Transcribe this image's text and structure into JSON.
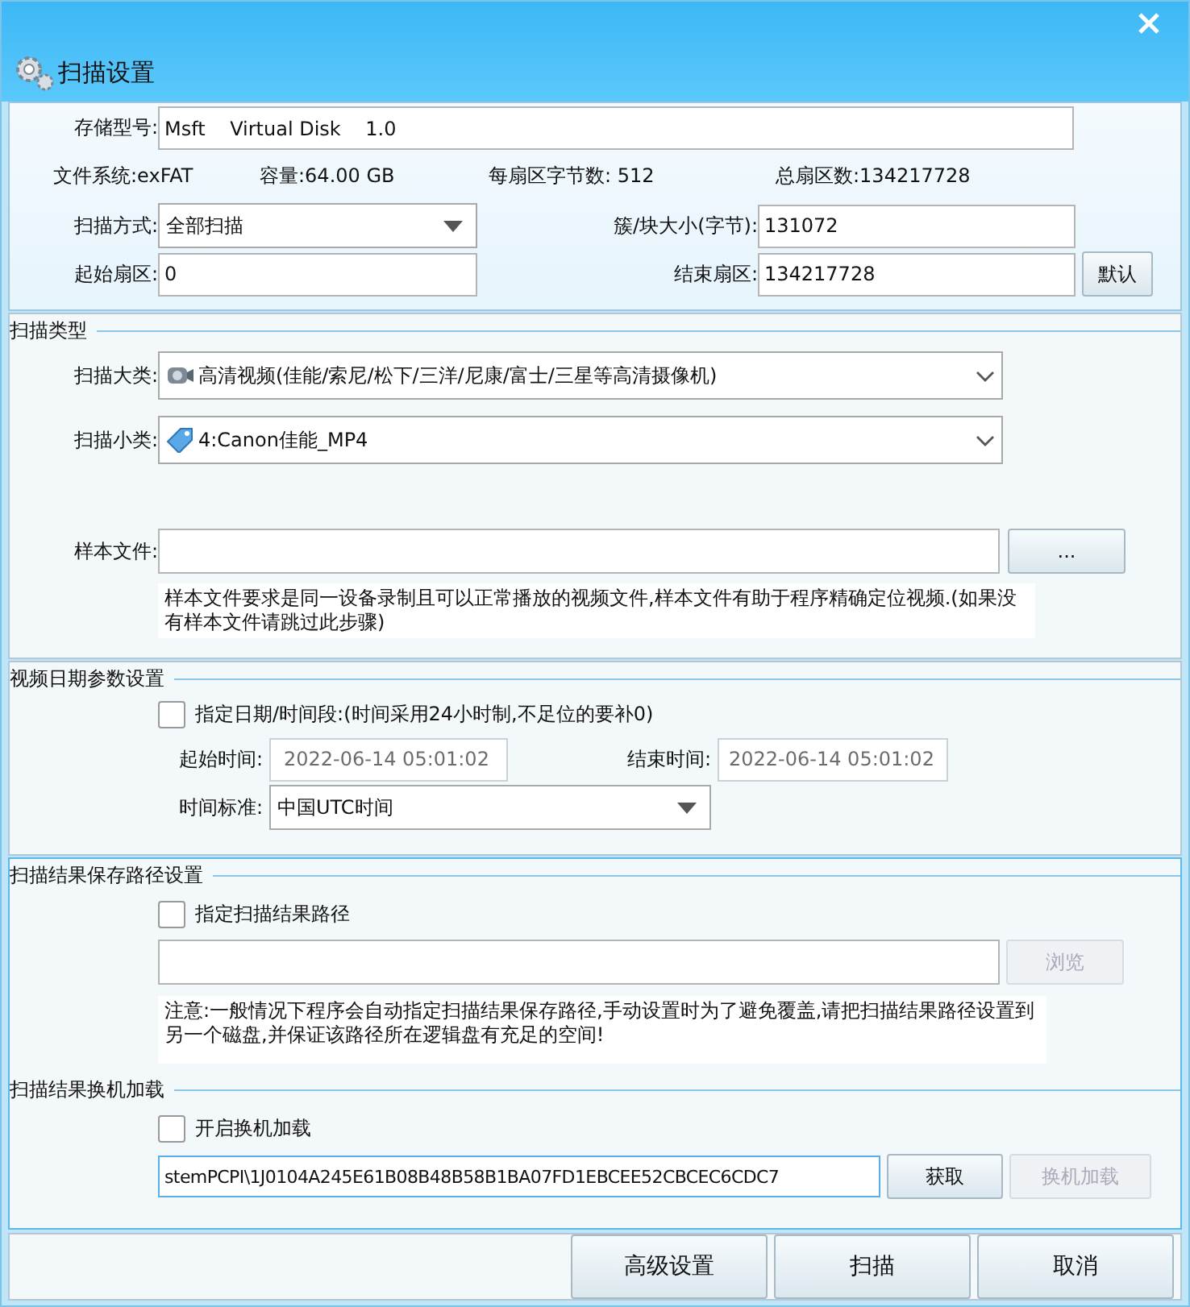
{
  "window": {
    "title": "扫描设置"
  },
  "disk": {
    "model_label": "存储型号:",
    "model": "Msft    Virtual Disk    1.0",
    "info": [
      "文件系统:exFAT",
      "容量:64.00 GB",
      "每扇区字节数: 512",
      "总扇区数:134217728"
    ],
    "scan_mode": {
      "label": "扫描方式:",
      "value": "全部扫描"
    },
    "cluster": {
      "label": "簇/块大小(字节):",
      "value": "131072"
    },
    "start": {
      "label": "起始扇区:",
      "value": "0"
    },
    "end": {
      "label": "结束扇区:",
      "value": "134217728"
    },
    "default_button": "默认"
  },
  "scan_type": {
    "title": "扫描类型",
    "major": {
      "label": "扫描大类:",
      "value": "高清视频(佳能/索尼/松下/三洋/尼康/富士/三星等高清摄像机)"
    },
    "minor": {
      "label": "扫描小类:",
      "value": "4:Canon佳能_MP4"
    },
    "sample": {
      "label": "样本文件:",
      "browse": "...",
      "note": "样本文件要求是同一设备录制且可以正常播放的视频文件,样本文件有助于程序精确定位视频.(如果没有样本文件请跳过此步骤)"
    }
  },
  "date": {
    "title": "视频日期参数设置",
    "specify": {
      "label": "指定日期/时间段:(时间采用24小时制,不足位的要补0)",
      "checked": false
    },
    "start": {
      "label": "起始时间:",
      "value": "2022-06-14 05:01:02",
      "disabled": true
    },
    "end": {
      "label": "结束时间:",
      "value": "2022-06-14 05:01:02",
      "disabled": true
    },
    "standard": {
      "label": "时间标准:",
      "value": "中国UTC时间"
    }
  },
  "save_path": {
    "title": "扫描结果保存路径设置",
    "specify": {
      "label": "指定扫描结果路径",
      "checked": false
    },
    "browse": {
      "label": "浏览",
      "disabled": true
    },
    "note": "注意:一般情况下程序会自动指定扫描结果保存路径,手动设置时为了避免覆盖,请把扫描结果路径设置到另一个磁盘,并保证该路径所在逻辑盘有充足的空间!"
  },
  "transfer": {
    "title": "扫描结果换机加载",
    "enable": {
      "label": "开启换机加载",
      "checked": false
    },
    "code": "stemPCPI\\1J0104A245E61B08B48B58B1BA07FD1EBCEE52CBCEC6CDC7",
    "fetch": {
      "label": "获取",
      "disabled": false
    },
    "load": {
      "label": "换机加载",
      "disabled": true
    }
  },
  "buttons": [
    "高级设置",
    "扫描",
    "取消"
  ]
}
